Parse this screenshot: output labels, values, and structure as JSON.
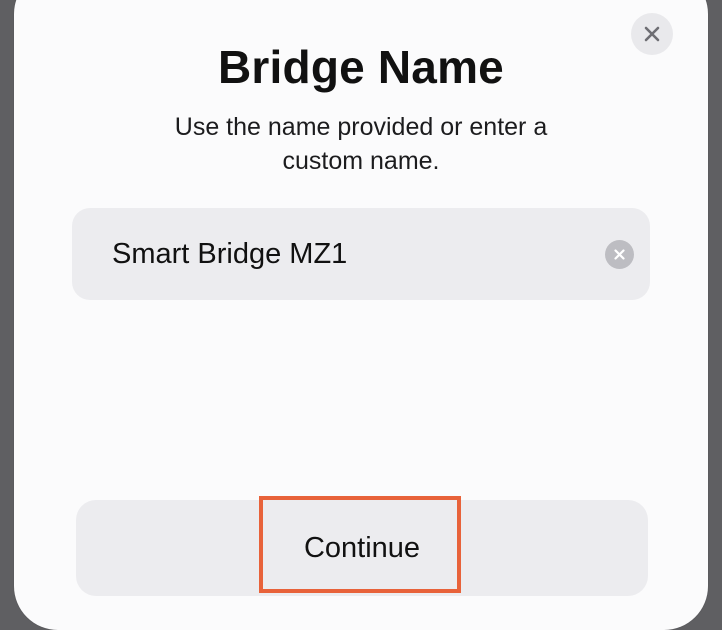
{
  "dialog": {
    "title": "Bridge Name",
    "subtitle": "Use the name provided or enter a custom name.",
    "close_icon": "close-icon"
  },
  "name_field": {
    "value": "Smart Bridge MZ1",
    "placeholder": "",
    "clear_icon": "clear-circle-icon"
  },
  "actions": {
    "continue_label": "Continue"
  },
  "colors": {
    "highlight": "#e8623a",
    "sheet": "#fbfbfc",
    "control_fill": "#ececef"
  }
}
